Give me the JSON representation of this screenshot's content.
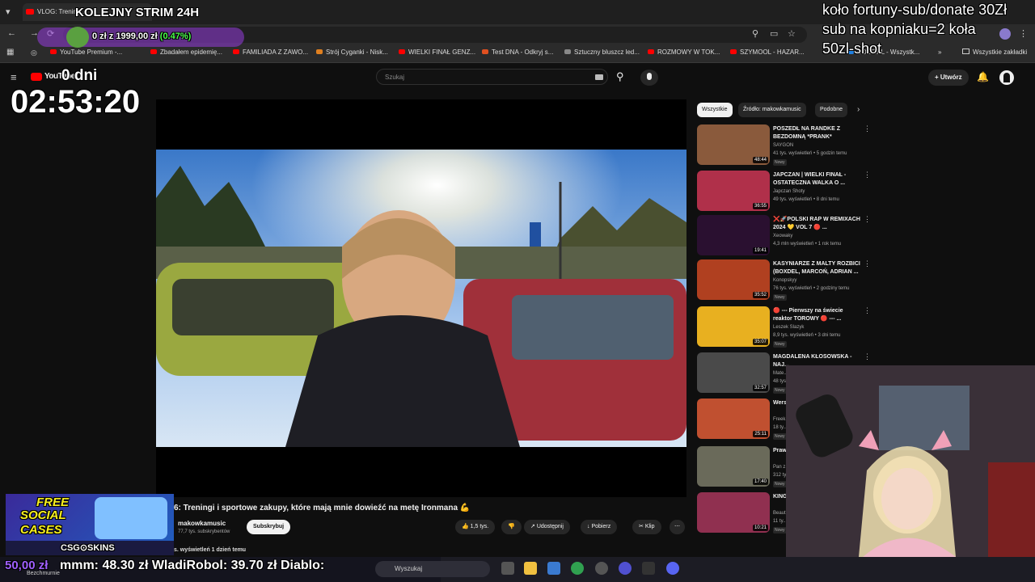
{
  "browser": {
    "tab_title": "VLOG: Trening...",
    "address_icons": [
      "zoom-icon",
      "cast-icon",
      "star-icon"
    ],
    "bookmarks": [
      {
        "label": "YouTube Premium -..."
      },
      {
        "label": "Zbadałem epidemię..."
      },
      {
        "label": "FAMILIADA Z ZAWO..."
      },
      {
        "label": "Strój Cyganki - Nisk..."
      },
      {
        "label": "WIELKI FINAŁ GENZ..."
      },
      {
        "label": "Test DNA - Odkryj s..."
      },
      {
        "label": "Sztuczny bluszcz led..."
      },
      {
        "label": "ROZMOWY W TOK..."
      },
      {
        "label": "SZYMOOL - HAZAR..."
      },
      {
        "label": "BOOP.PL - Wszystk..."
      }
    ],
    "all_bookmarks": "Wszystkie zakładki"
  },
  "youtube": {
    "logo": "YouTube",
    "search_placeholder": "Szukaj",
    "create_label": "Utwórz",
    "chips": [
      "Wszystkie",
      "Źródło: makowkamusic",
      "Podobne"
    ],
    "video_title": "6: Treningi i sportowe zakupy, które mają mnie dowieźć na metę Ironmana 💪",
    "channel": "makowkamusic",
    "subscribers": "77,7 tys. subskrybentów",
    "subscribe_label": "Subskrybuj",
    "likes": "1,5 tys.",
    "share_label": "Udostępnij",
    "download_label": "Pobierz",
    "clip_label": "Klip",
    "views_line": "s. wyświetleń  1 dzień temu",
    "recommendations": [
      {
        "title": "POSZEDŁ NA RANDKE Z BEZDOMNĄ *PRANK*",
        "channel": "SAYGON",
        "meta": "41 tys. wyświetleń • 5 godzin temu",
        "badge": "Nowy",
        "duration": "48:44",
        "color": "#8a5a3c"
      },
      {
        "title": "JAPCZAN | WIELKI FINAŁ - OSTATECZNA WALKA O ...",
        "channel": "Japczan Shoty",
        "meta": "49 tys. wyświetleń • 8 dni temu",
        "badge": "",
        "duration": "36:55",
        "color": "#b0304a"
      },
      {
        "title": "❌🚀POLSKI RAP W REMIXACH 2024 💛 VOL 7 🔴 ...",
        "channel": "Xeowaky",
        "meta": "4,3 mln wyświetleń • 1 rok temu",
        "badge": "",
        "duration": "19:41",
        "color": "#2a1030"
      },
      {
        "title": "KASYNIARZE Z MALTY ROZBICI (BOXDEL, MARCOŃ, ADRIAN ...",
        "channel": "Konopskyy",
        "meta": "76 tys. wyświetleń • 2 godziny temu",
        "badge": "Nowy",
        "duration": "35:52",
        "color": "#b04020"
      },
      {
        "title": "🔴 --- Pierwszy na świecie reaktor TOROWY 🔴 --- ...",
        "channel": "Leszek Slazyk",
        "meta": "8,9 tys. wyświetleń • 3 dni temu",
        "badge": "Nowy",
        "duration": "35:07",
        "color": "#e8b020"
      },
      {
        "title": "MAGDALENA KŁOSOWSKA - NAJ...",
        "channel": "Mate...",
        "meta": "48 tys...",
        "badge": "Nowy",
        "duration": "32:57",
        "color": "#4a4a4a"
      },
      {
        "title": "Wers... FAZA...",
        "channel": "Freek...",
        "meta": "18 ty...",
        "badge": "Nowy",
        "duration": "25:11",
        "color": "#c05030"
      },
      {
        "title": "Praw... 305 ...",
        "channel": "Pan z...",
        "meta": "312 ty...",
        "badge": "Nowy",
        "duration": "17:40",
        "color": "#6a6a5a"
      },
      {
        "title": "KING... ZWIA...",
        "channel": "Beaut...",
        "meta": "11 ty...",
        "badge": "Nowy",
        "duration": "10:21",
        "color": "#903050"
      }
    ]
  },
  "overlay": {
    "stream_title": "KOLEJNY STRIM 24H",
    "donation_progress": "0 zł z 1999,00 zł",
    "donation_percent": "(0.47%)",
    "days": "0 dni",
    "timer": "02:53:20",
    "wheel_line1": "koło fortuny-sub/donate 30Zł",
    "wheel_line2": "sub na kopniaku=2 koła",
    "wheel_line3": "50zl-shot",
    "ad_line1": "FREE",
    "ad_line2": "SOCIAL",
    "ad_line3": "CASES",
    "ad_brand": "CSG⊙SKINS",
    "ticker": "mmm: 48.30 zł  WladiRobol: 39.70 zł  Diablo:",
    "ticker_left": "50,00 zł",
    "ticker_bottom": "Bezchmurnie",
    "taskbar_search": "Wyszukaj"
  }
}
